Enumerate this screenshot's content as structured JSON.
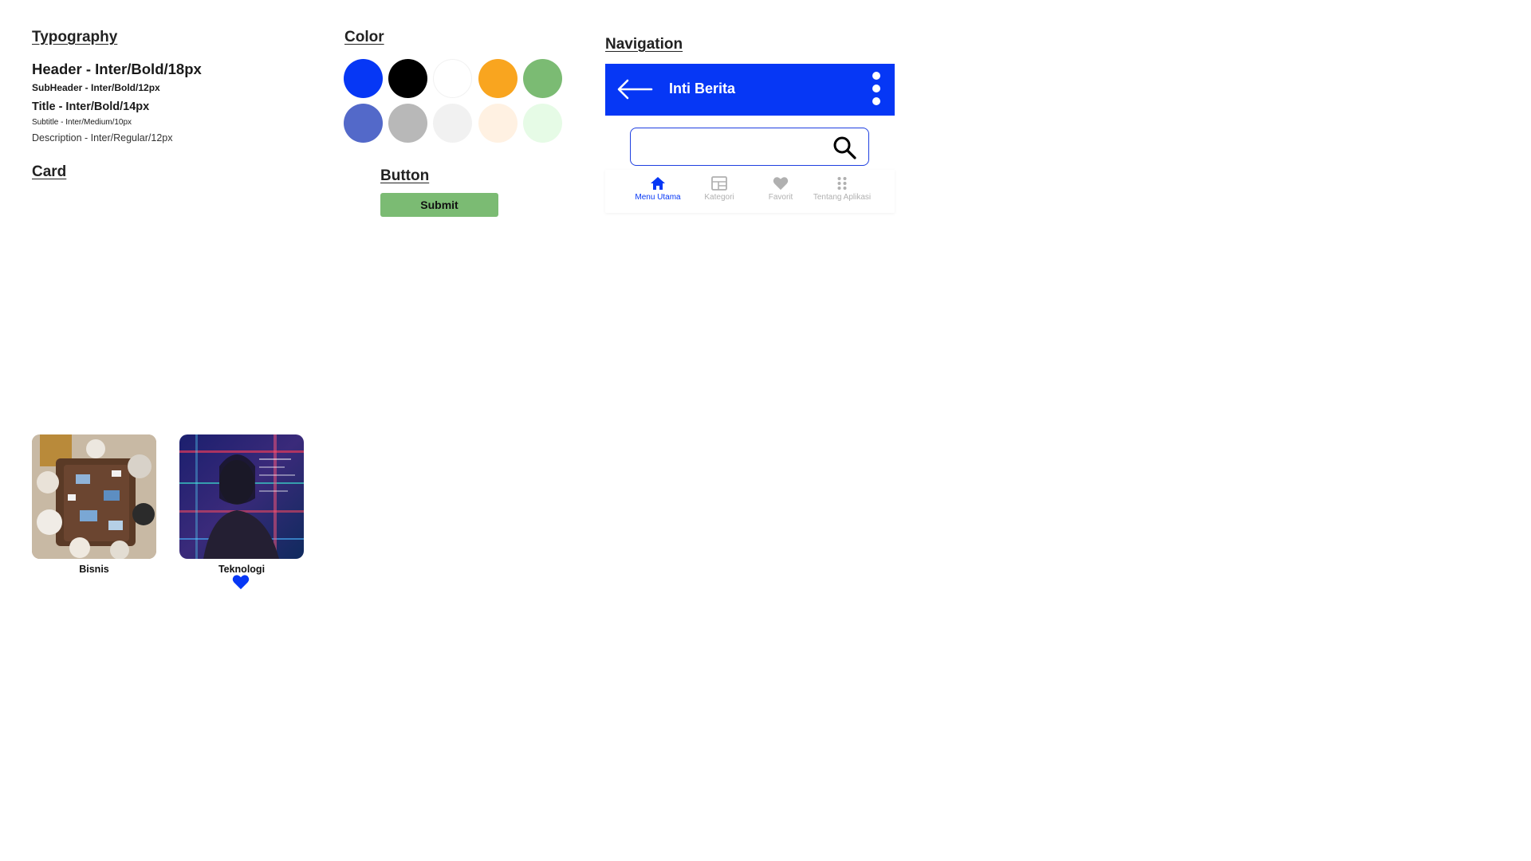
{
  "typography": {
    "section_title": "Typography",
    "header": "Header - Inter/Bold/18px",
    "subheader": "SubHeader - Inter/Bold/12px",
    "title": "Title - Inter/Bold/14px",
    "subtitle": "Subtitle - Inter/Medium/10px",
    "description": "Description - Inter/Regular/12px"
  },
  "color": {
    "section_title": "Color",
    "swatches_row1": [
      "#0637f5",
      "#000000",
      "#ffffff",
      "#f9a51f",
      "#7bbb73"
    ],
    "swatches_row2": [
      "#5369c9",
      "#b8b8b8",
      "#f1f1f1",
      "#fff1e2",
      "#e6fbe6"
    ]
  },
  "navigation": {
    "section_title": "Navigation",
    "app_bar_title": "Inti Berita",
    "app_bar_color": "#0637f5",
    "search_value": "",
    "bottom_nav": [
      {
        "label": "Menu Utama",
        "icon": "home-icon",
        "active": true
      },
      {
        "label": "Kategori",
        "icon": "category-icon",
        "active": false
      },
      {
        "label": "Favorit",
        "icon": "heart-icon",
        "active": false
      },
      {
        "label": "Tentang Aplikasi",
        "icon": "apps-icon",
        "active": false
      }
    ]
  },
  "button": {
    "section_title": "Button",
    "submit_label": "Submit",
    "submit_color": "#7bbb73"
  },
  "card": {
    "section_title": "Card",
    "items": [
      {
        "label": "Bisnis",
        "image": "business-meeting-photo",
        "favorited": false
      },
      {
        "label": "Teknologi",
        "image": "technology-photo",
        "favorited": true
      }
    ]
  }
}
